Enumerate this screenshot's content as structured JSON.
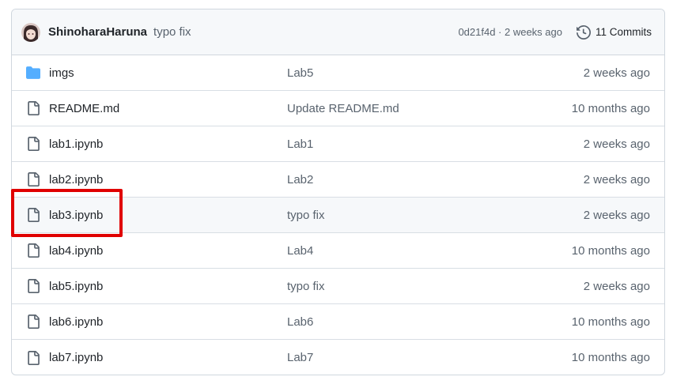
{
  "header": {
    "author": "ShinoharaHaruna",
    "commit_message": "typo fix",
    "commit_meta": "0d21f4d · 2 weeks ago",
    "commits_label": "11 Commits"
  },
  "files": [
    {
      "name": "imgs",
      "type": "folder",
      "message": "Lab5",
      "age": "2 weeks ago"
    },
    {
      "name": "README.md",
      "type": "file",
      "message": "Update README.md",
      "age": "10 months ago"
    },
    {
      "name": "lab1.ipynb",
      "type": "file",
      "message": "Lab1",
      "age": "2 weeks ago"
    },
    {
      "name": "lab2.ipynb",
      "type": "file",
      "message": "Lab2",
      "age": "2 weeks ago"
    },
    {
      "name": "lab3.ipynb",
      "type": "file",
      "message": "typo fix",
      "age": "2 weeks ago"
    },
    {
      "name": "lab4.ipynb",
      "type": "file",
      "message": "Lab4",
      "age": "10 months ago"
    },
    {
      "name": "lab5.ipynb",
      "type": "file",
      "message": "typo fix",
      "age": "2 weeks ago"
    },
    {
      "name": "lab6.ipynb",
      "type": "file",
      "message": "Lab6",
      "age": "10 months ago"
    },
    {
      "name": "lab7.ipynb",
      "type": "file",
      "message": "Lab7",
      "age": "10 months ago"
    }
  ],
  "highlighted_file": "lab3.ipynb",
  "colors": {
    "folder_icon": "#54aeff",
    "file_icon": "#59636e",
    "highlight_border": "#e00000"
  }
}
